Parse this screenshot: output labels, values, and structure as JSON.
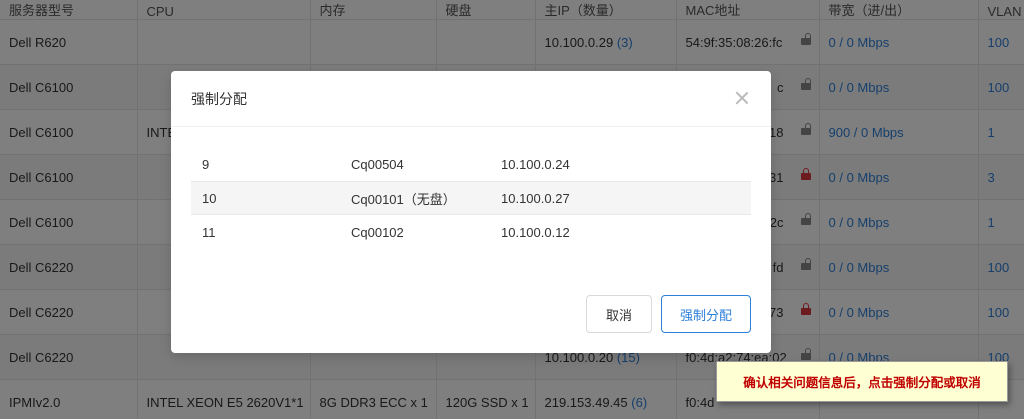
{
  "background_table": {
    "headers": [
      "服务器型号",
      "CPU",
      "内存",
      "硬盘",
      "主IP（数量）",
      "MAC地址",
      "带宽（进/出）",
      "VLAN"
    ],
    "rows": [
      {
        "model": "Dell R620",
        "cpu": "",
        "mem": "",
        "disk": "",
        "ip": "10.100.0.29",
        "ip_count": "(3)",
        "mac": "54:9f:35:08:26:fc",
        "lock": "open",
        "bandwidth": "0 / 0 Mbps",
        "vlan": "100"
      },
      {
        "model": "Dell C6100",
        "cpu": "",
        "mem": "",
        "disk": "",
        "ip": "",
        "ip_count": "",
        "mac": "c",
        "lock": "open",
        "bandwidth": "0 / 0 Mbps",
        "vlan": "100"
      },
      {
        "model": "Dell C6100",
        "cpu": "INTE",
        "mem": "",
        "disk": "",
        "ip": "",
        "ip_count": "",
        "mac": "18",
        "lock": "open",
        "bandwidth": "900 / 0 Mbps",
        "vlan": "1"
      },
      {
        "model": "Dell C6100",
        "cpu": "",
        "mem": "",
        "disk": "",
        "ip": "",
        "ip_count": "",
        "mac": "31",
        "lock": "red",
        "bandwidth": "0 / 0 Mbps",
        "vlan": "3"
      },
      {
        "model": "Dell C6100",
        "cpu": "",
        "mem": "",
        "disk": "",
        "ip": "",
        "ip_count": "",
        "mac": "2c",
        "lock": "open",
        "bandwidth": "0 / 0 Mbps",
        "vlan": "1"
      },
      {
        "model": "Dell C6220",
        "cpu": "",
        "mem": "",
        "disk": "",
        "ip": "",
        "ip_count": "",
        "mac": "fd",
        "lock": "open",
        "bandwidth": "0 / 0 Mbps",
        "vlan": "100"
      },
      {
        "model": "Dell C6220",
        "cpu": "",
        "mem": "",
        "disk": "",
        "ip": "",
        "ip_count": "",
        "mac": "73",
        "lock": "red",
        "bandwidth": "0 / 0 Mbps",
        "vlan": "100"
      },
      {
        "model": "Dell C6220",
        "cpu": "",
        "mem": "",
        "disk": "",
        "ip": "10.100.0.20",
        "ip_count": "(15)",
        "mac": "f0:4d:a2:74:ea:02",
        "lock": "open",
        "bandwidth": "0 / 0 Mbps",
        "vlan": "100"
      },
      {
        "model": "IPMIv2.0",
        "cpu": "INTEL XEON E5 2620V1*1",
        "mem": "8G DDR3 ECC x 1",
        "disk": "120G SSD x 1",
        "ip": "219.153.49.45",
        "ip_count": "(6)",
        "mac": "f0:4d",
        "lock": "",
        "bandwidth": "",
        "vlan": ""
      }
    ]
  },
  "modal": {
    "title": "强制分配",
    "rows": [
      {
        "no": "9",
        "name": "Cq00504",
        "ip": "10.100.0.24"
      },
      {
        "no": "10",
        "name": "Cq00101（无盘）",
        "ip": "10.100.0.27"
      },
      {
        "no": "11",
        "name": "Cq00102",
        "ip": "10.100.0.12"
      }
    ],
    "cancel_label": "取消",
    "confirm_label": "强制分配"
  },
  "tooltip": {
    "text": "确认相关问题信息后，点击强制分配或取消"
  }
}
